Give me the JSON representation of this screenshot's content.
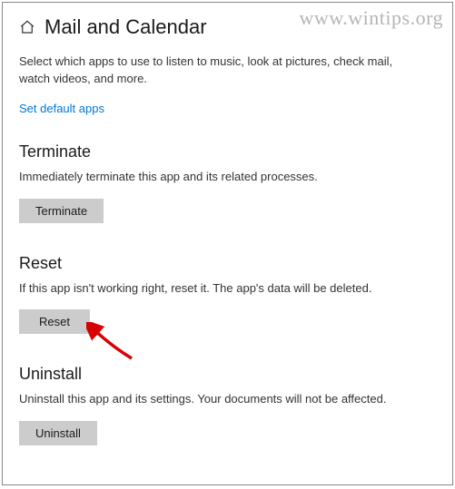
{
  "watermark": "www.wintips.org",
  "header": {
    "title": "Mail and Calendar"
  },
  "intro": "Select which apps to use to listen to music, look at pictures, check mail, watch videos, and more.",
  "link_text": "Set default apps",
  "sections": {
    "terminate": {
      "title": "Terminate",
      "desc": "Immediately terminate this app and its related processes.",
      "button": "Terminate"
    },
    "reset": {
      "title": "Reset",
      "desc": "If this app isn't working right, reset it. The app's data will be deleted.",
      "button": "Reset"
    },
    "uninstall": {
      "title": "Uninstall",
      "desc": "Uninstall this app and its settings. Your documents will not be affected.",
      "button": "Uninstall"
    }
  }
}
